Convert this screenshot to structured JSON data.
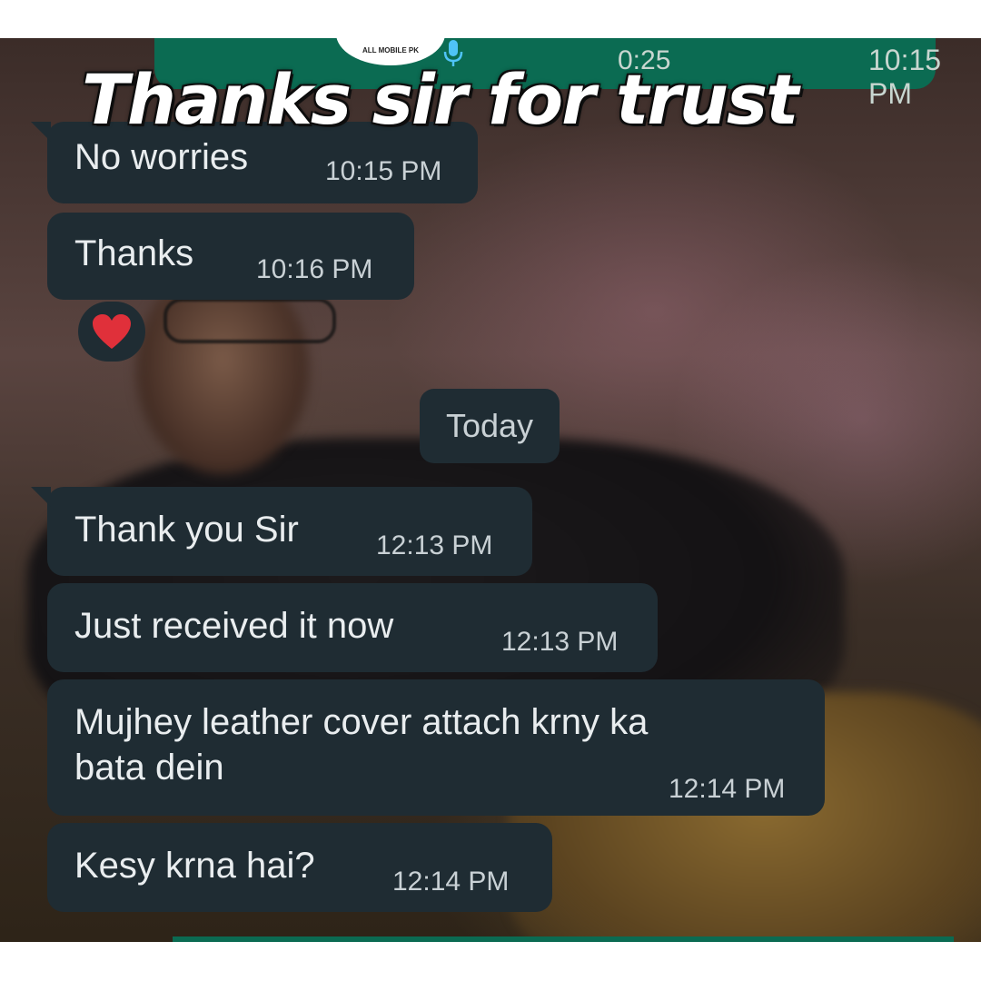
{
  "headline": "Thanks sir for trust",
  "voice_message": {
    "duration": "0:25",
    "time": "10:15 PM",
    "logo_text": "ALL MOBILE PK",
    "status_icon": "double-check-icon",
    "mic_icon": "mic-icon"
  },
  "messages": [
    {
      "text": "No worries",
      "time": "10:15 PM"
    },
    {
      "text": "Thanks",
      "time": "10:16 PM"
    },
    {
      "text": "Thank you Sir",
      "time": "12:13 PM"
    },
    {
      "text": "Just received it now",
      "time": "12:13 PM"
    },
    {
      "text": "Mujhey leather cover attach krny ka\nbata dein",
      "time": "12:14 PM"
    },
    {
      "text": "Kesy krna hai?",
      "time": "12:14 PM"
    }
  ],
  "reaction": {
    "emoji": "heart-icon",
    "color": "#e0303a"
  },
  "date_divider": "Today",
  "colors": {
    "bubble": "#1f2c33",
    "header_green": "#0b6b52",
    "text": "#e9edef",
    "time_text": "#c9d1d5"
  }
}
